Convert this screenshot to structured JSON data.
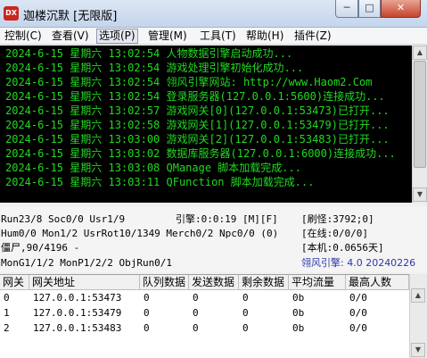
{
  "window": {
    "icon_text": "DX",
    "title": "迦楼沉默 [无限版]",
    "minimize_glyph": "─",
    "maximize_glyph": "□",
    "close_glyph": "✕"
  },
  "menu": [
    {
      "label": "控制(C)"
    },
    {
      "label": "查看(V)"
    },
    {
      "label": "选项(P)"
    },
    {
      "label": "管理(M)"
    },
    {
      "label": "工具(T)"
    },
    {
      "label": "帮助(H)"
    },
    {
      "label": "插件(Z)"
    }
  ],
  "log": {
    "lines": [
      "2024-6-15 星期六 13:02:54 人物数据引擎启动成功...",
      "2024-6-15 星期六 13:02:54 游戏处理引擎初始化成功...",
      "2024-6-15 星期六 13:02:54 翎风引擎网站: http://www.Haom2.Com",
      "2024-6-15 星期六 13:02:54 登录服务器(127.0.0.1:5600)连接成功...",
      "2024-6-15 星期六 13:02:57 游戏网关[0](127.0.0.1:53473)已打开...",
      "2024-6-15 星期六 13:02:58 游戏网关[1](127.0.0.1:53479)已打开...",
      "2024-6-15 星期六 13:03:00 游戏网关[2](127.0.0.1:53483)已打开...",
      "2024-6-15 星期六 13:03:02 数据库服务器(127.0.0.1:6000)连接成功...",
      "2024-6-15 星期六 13:03:08 QManage 脚本加载完成...",
      "2024-6-15 星期六 13:03:11 QFunction 脚本加载完成..."
    ]
  },
  "status": {
    "row1_left": "Run23/8 Soc0/0 Usr1/9",
    "row1_mid": "引擎:0:0:19 [M][F]",
    "row1_right": "[刷怪:3792;0]",
    "row2_left": "Hum0/0 Mon1/2 UsrRot10/1349 Merch0/2 Npc0/0 (0)",
    "row2_right": "[在线:0/0/0]",
    "row3_left": "僵尸,90/4196 -",
    "row3_right": "[本机:0.0656天]",
    "row4_left": "MonG1/1/2 MonP1/2/2 ObjRun0/1",
    "row4_right": "翎风引擎: 4.0 20240226"
  },
  "table": {
    "headers": [
      "网关",
      "网关地址",
      "队列数据",
      "发送数据",
      "剩余数据",
      "平均流量",
      "最高人数"
    ],
    "rows": [
      [
        "0",
        "127.0.0.1:53473",
        "0",
        "0",
        "0",
        "0b",
        "0/0"
      ],
      [
        "1",
        "127.0.0.1:53479",
        "0",
        "0",
        "0",
        "0b",
        "0/0"
      ],
      [
        "2",
        "127.0.0.1:53483",
        "0",
        "0",
        "0",
        "0b",
        "0/0"
      ]
    ]
  }
}
